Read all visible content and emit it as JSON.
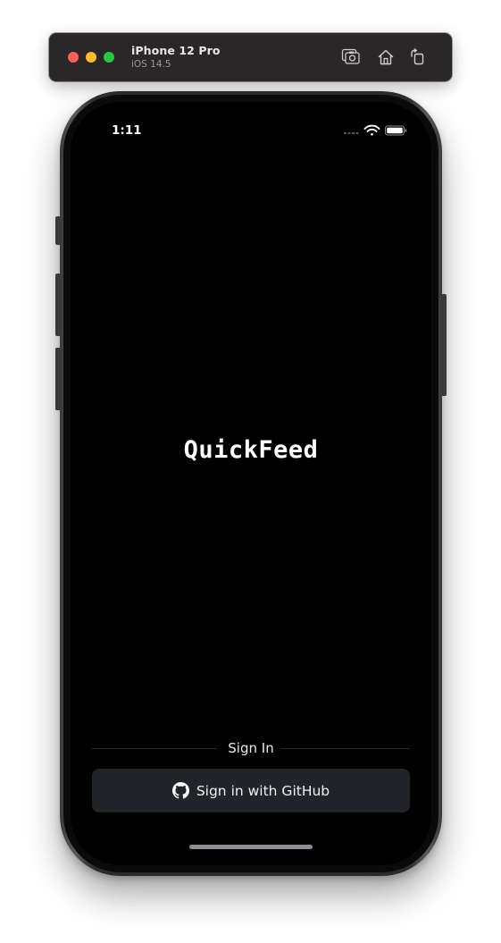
{
  "simulator": {
    "device_name": "iPhone 12 Pro",
    "os_version": "iOS 14.5",
    "toolbar_icons": [
      "screenshot-icon",
      "home-icon",
      "rotate-icon"
    ]
  },
  "status_bar": {
    "time": "1:11",
    "icons": [
      "cellular-signal-icon",
      "wifi-icon",
      "battery-icon"
    ]
  },
  "app": {
    "title": "QuickFeed",
    "divider_label": "Sign In",
    "github_button_label": "Sign in with GitHub",
    "github_icon": "github-icon"
  },
  "colors": {
    "screen_background": "#000000",
    "button_background": "#212529",
    "text": "#ffffff"
  }
}
